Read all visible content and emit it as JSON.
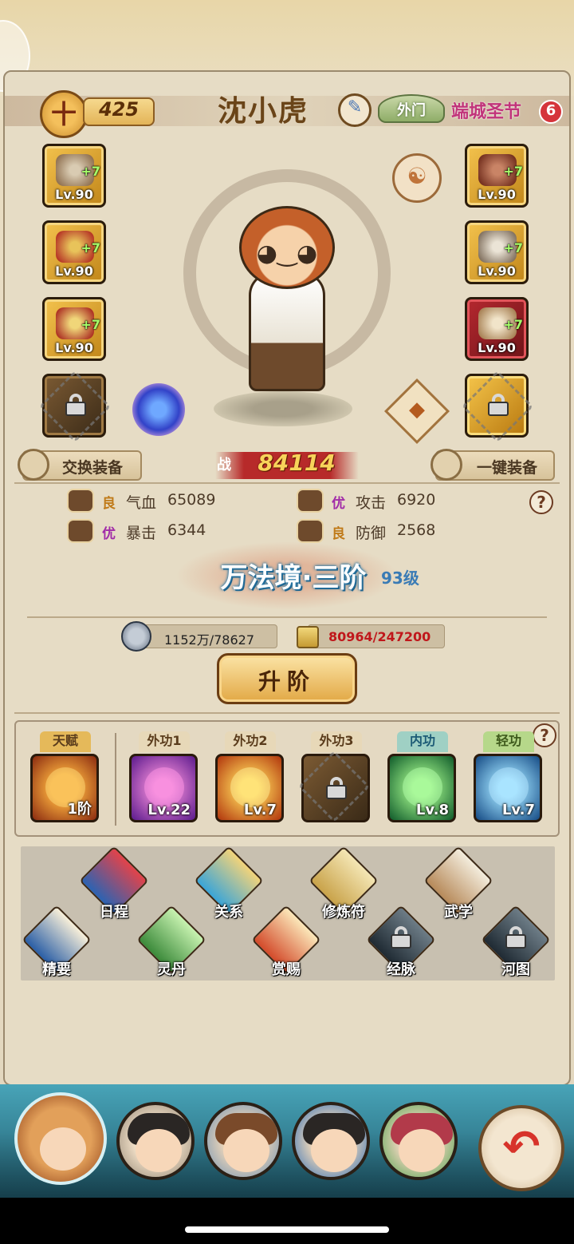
{
  "header": {
    "badge_glyph": "十",
    "level_value": "425",
    "character_name": "沈小虎",
    "sect_label": "外门",
    "event_label": "端城圣节",
    "event_count": "6"
  },
  "equipment": {
    "left": [
      {
        "lv": "Lv.90",
        "plus": "+7",
        "icon": "hat-icon"
      },
      {
        "lv": "Lv.90",
        "plus": "+7",
        "icon": "armor-icon"
      },
      {
        "lv": "Lv.90",
        "plus": "+7",
        "icon": "belt-icon"
      },
      {
        "lv": "",
        "plus": "",
        "icon": "lock-icon"
      }
    ],
    "right": [
      {
        "lv": "Lv.90",
        "plus": "+7",
        "icon": "cap-icon"
      },
      {
        "lv": "Lv.90",
        "plus": "+7",
        "icon": "bracer-icon"
      },
      {
        "lv": "Lv.90",
        "plus": "+7",
        "icon": "boots-icon"
      },
      {
        "lv": "",
        "plus": "",
        "icon": "lock-icon"
      }
    ]
  },
  "buttons": {
    "swap_equipment": "交换装备",
    "one_key_equip": "一键装备",
    "upgrade": "升阶"
  },
  "power": {
    "prefix": "战",
    "value": "84114"
  },
  "stats": [
    {
      "quality": "良",
      "label": "气血",
      "value": "65089"
    },
    {
      "quality": "优",
      "label": "攻击",
      "value": "6920"
    },
    {
      "quality": "优",
      "label": "暴击",
      "value": "6344"
    },
    {
      "quality": "良",
      "label": "防御",
      "value": "2568"
    }
  ],
  "realm": {
    "name": "万法境·三阶",
    "level": "93级"
  },
  "resources": {
    "coins": "1152万/78627",
    "scrolls": "80964/247200"
  },
  "skills": [
    {
      "tag": "天赋",
      "lv": "1阶",
      "color": "#c8551c"
    },
    {
      "tag": "外功1",
      "lv": "Lv.22",
      "color": "#8a2fc0"
    },
    {
      "tag": "外功2",
      "lv": "Lv.7",
      "color": "#e07a16"
    },
    {
      "tag": "外功3",
      "lv": "",
      "color": "#5e4d3b"
    },
    {
      "tag": "内功",
      "lv": "Lv.8",
      "color": "#1f8a3c"
    },
    {
      "tag": "轻功",
      "lv": "Lv.7",
      "color": "#2b6fb6"
    }
  ],
  "functions": [
    {
      "label": "日程",
      "icon": "schedule-icon"
    },
    {
      "label": "关系",
      "icon": "relation-icon"
    },
    {
      "label": "修炼符",
      "icon": "talisman-icon"
    },
    {
      "label": "武学",
      "icon": "martial-scroll-icon"
    },
    {
      "label": "精要",
      "icon": "book-icon"
    },
    {
      "label": "灵丹",
      "icon": "elixir-icon"
    },
    {
      "label": "赏赐",
      "icon": "fan-icon"
    },
    {
      "label": "经脉",
      "icon": "lock-icon"
    },
    {
      "label": "河图",
      "icon": "lock-icon"
    }
  ],
  "colors": {
    "power_value": "#f8d35a",
    "resource_warning": "#c0171b",
    "realm_text_glow": "#2b7aa8"
  }
}
